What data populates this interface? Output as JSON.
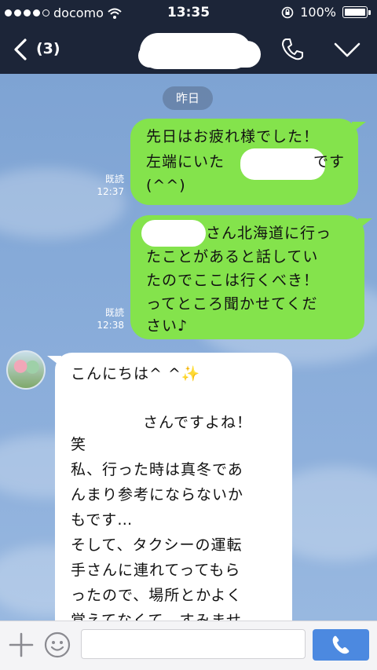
{
  "status_bar": {
    "carrier": "docomo",
    "time": "13:35",
    "battery": "100%"
  },
  "nav": {
    "unread_count": "(3)"
  },
  "chat": {
    "date_label": "昨日",
    "messages": [
      {
        "direction": "out",
        "read_label": "既読",
        "time": "12:37",
        "lines": [
          "先日はお疲れ様でした！",
          "左端にいた",
          "です",
          "(^^)"
        ]
      },
      {
        "direction": "out",
        "read_label": "既読",
        "time": "12:38",
        "lines": [
          "さん北海道に行っ",
          "たことがあると話してい",
          "たのでここは行くべき！",
          "ってところ聞かせてくだ",
          "さい♪"
        ]
      },
      {
        "direction": "in",
        "lines": [
          "こんにちは^ ^✨",
          "",
          "さんですよね！",
          "笑",
          "私、行った時は真冬であ",
          "んまり参考にならないか",
          "もです…",
          "そして、タクシーの運転",
          "手さんに連れてってもら",
          "ったので、場所とかよく",
          "覚えてなくて…すみませ"
        ]
      }
    ]
  },
  "input_bar": {
    "message_value": ""
  },
  "colors": {
    "header_bg": "#1c2538",
    "outgoing_bubble": "#84e34c",
    "incoming_bubble": "#ffffff",
    "chat_bg": "#86aad8",
    "call_button": "#4c89e0"
  },
  "icons": [
    "signal-dots-icon",
    "wifi-icon",
    "orientation-lock-icon",
    "battery-icon",
    "back-chevron-icon",
    "phone-icon",
    "chevron-down-icon",
    "plus-icon",
    "emoji-icon",
    "phone-call-icon"
  ]
}
